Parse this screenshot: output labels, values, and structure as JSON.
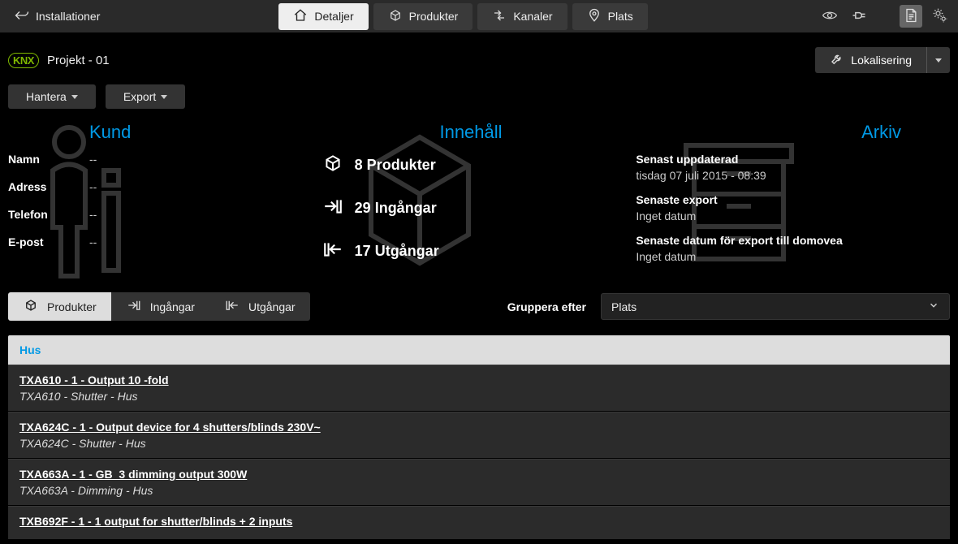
{
  "topbar": {
    "back": "Installationer",
    "tabs": {
      "details": "Detaljer",
      "products": "Produkter",
      "channels": "Kanaler",
      "location": "Plats"
    }
  },
  "project": {
    "logo": "KNX",
    "name": "Projekt - 01",
    "localize": "Lokalisering"
  },
  "actions": {
    "manage": "Hantera",
    "export": "Export"
  },
  "customer": {
    "title": "Kund",
    "name_label": "Namn",
    "name_value": "--",
    "address_label": "Adress",
    "address_value": "--",
    "phone_label": "Telefon",
    "phone_value": "--",
    "email_label": "E-post",
    "email_value": "--"
  },
  "content": {
    "title": "Innehåll",
    "products": "8 Produkter",
    "inputs": "29 Ingångar",
    "outputs": "17 Utgångar"
  },
  "archive": {
    "title": "Arkiv",
    "updated_label": "Senast uppdaterad",
    "updated_value": "tisdag 07 juli 2015 - 08:39",
    "export_label": "Senaste export",
    "export_value": "Inget datum",
    "domovea_label": "Senaste datum för export till domovea",
    "domovea_value": "Inget datum"
  },
  "subtabs": {
    "products": "Produkter",
    "inputs": "Ingångar",
    "outputs": "Utgångar"
  },
  "group": {
    "label": "Gruppera efter",
    "selected": "Plats"
  },
  "list": {
    "header": "Hus",
    "rows": [
      {
        "title": "TXA610 - 1 - Output 10 -fold",
        "sub": "TXA610 - Shutter - Hus"
      },
      {
        "title": "TXA624C - 1 - Output device for 4 shutters/blinds 230V~",
        "sub": "TXA624C - Shutter - Hus"
      },
      {
        "title": "TXA663A - 1 - GB_3 dimming output 300W",
        "sub": "TXA663A - Dimming - Hus"
      },
      {
        "title": "TXB692F - 1 - 1 output for shutter/blinds + 2 inputs",
        "sub": ""
      }
    ]
  }
}
